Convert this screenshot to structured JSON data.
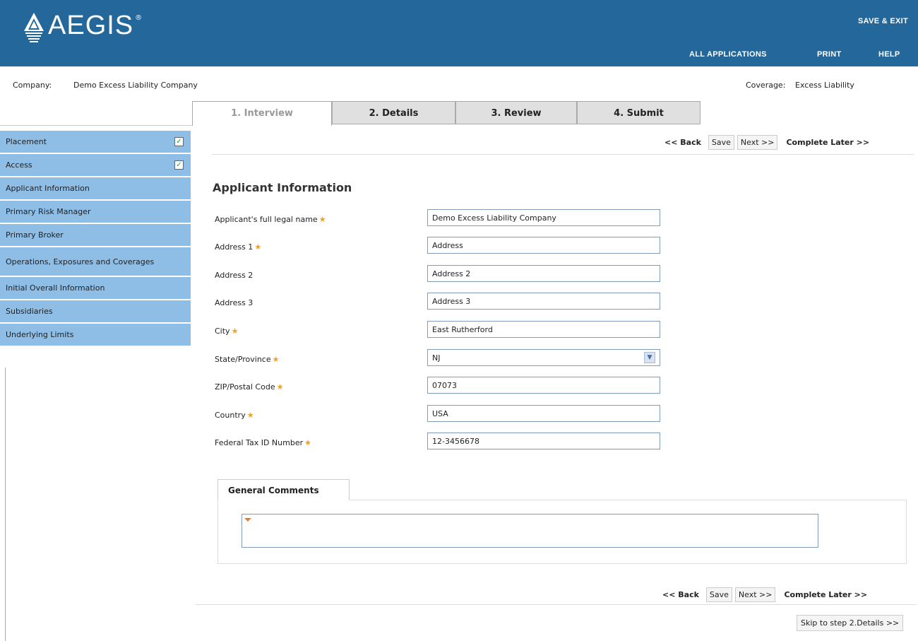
{
  "header": {
    "logo_text": "AEGIS",
    "logo_reg": "®",
    "save_exit": "SAVE & EXIT",
    "all_applications": "ALL APPLICATIONS",
    "print": "PRINT",
    "help": "HELP",
    "background_color": "#24679a"
  },
  "context": {
    "company_label": "Company:",
    "company_name": "Demo Excess Liability Company",
    "coverage_label": "Coverage:",
    "coverage_value": "Excess Liability"
  },
  "tabs": [
    {
      "label": "1. Interview",
      "active": true
    },
    {
      "label": "2. Details",
      "active": false
    },
    {
      "label": "3. Review",
      "active": false
    },
    {
      "label": "4. Submit",
      "active": false
    }
  ],
  "sidebar": {
    "color": "#8ebde6",
    "items": [
      {
        "label": "Placement",
        "checked": true
      },
      {
        "label": "Access",
        "checked": true
      },
      {
        "label": "Applicant Information",
        "checked": false
      },
      {
        "label": "Primary Risk Manager",
        "checked": false
      },
      {
        "label": "Primary Broker",
        "checked": false
      },
      {
        "label": "Operations, Exposures and Coverages",
        "checked": false
      },
      {
        "label": "Initial Overall Information",
        "checked": false
      },
      {
        "label": "Subsidiaries",
        "checked": false
      },
      {
        "label": "Underlying Limits",
        "checked": false
      }
    ]
  },
  "nav": {
    "back": "<< Back",
    "save": "Save",
    "next": "Next >>",
    "complete_later": "Complete Later >>"
  },
  "section_title": "Applicant Information",
  "form": {
    "fields": [
      {
        "label": "Applicant's full legal name",
        "required": true,
        "value": "Demo Excess Liability Company"
      },
      {
        "label": "Address 1",
        "required": true,
        "value": "Address"
      },
      {
        "label": "Address 2",
        "required": false,
        "value": "Address 2"
      },
      {
        "label": "Address 3",
        "required": false,
        "value": "Address 3"
      },
      {
        "label": "City",
        "required": true,
        "value": "East Rutherford"
      },
      {
        "label": "State/Province",
        "required": true,
        "value": "NJ"
      },
      {
        "label": "ZIP/Postal Code",
        "required": true,
        "value": "07073"
      },
      {
        "label": "Country",
        "required": true,
        "value": "USA"
      },
      {
        "label": "Federal Tax ID Number",
        "required": true,
        "value": "12-3456678"
      }
    ],
    "required_marker": "★",
    "select_arrow": "▼"
  },
  "comments": {
    "tab_label": "General Comments",
    "value": ""
  },
  "skip_link": "Skip to step 2.Details >>",
  "checkmark": "✓"
}
